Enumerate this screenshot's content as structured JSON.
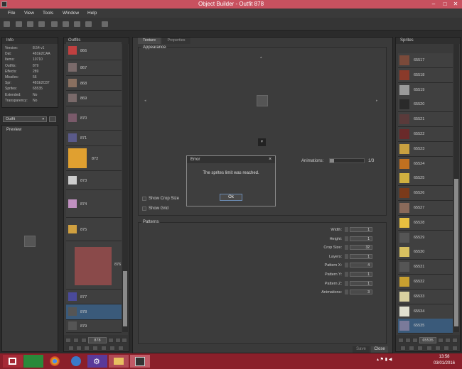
{
  "window": {
    "title": "Object Builder - Outfit 878",
    "minimize": "–",
    "maximize": "□",
    "close": "✕"
  },
  "menu": [
    "File",
    "View",
    "Tools",
    "Window",
    "Help"
  ],
  "info": {
    "header": "Info",
    "rows": [
      {
        "k": "Version:",
        "v": "8.54 v1"
      },
      {
        "k": "Dat:",
        "v": "481E2CAA"
      },
      {
        "k": "Items:",
        "v": "10710"
      },
      {
        "k": "Outfits:",
        "v": "879"
      },
      {
        "k": "Effects:",
        "v": "289"
      },
      {
        "k": "Missiles:",
        "v": "56"
      },
      {
        "k": "Spr:",
        "v": "481E2C87"
      },
      {
        "k": "Sprites:",
        "v": "65535"
      },
      {
        "k": "Extended:",
        "v": "No"
      },
      {
        "k": "Transparency:",
        "v": "No"
      }
    ]
  },
  "category_select": "Outfit",
  "preview_label": "Preview",
  "outfits": {
    "header": "Outfits",
    "items": [
      "866",
      "867",
      "868",
      "869",
      "870",
      "871",
      "872",
      "873",
      "874",
      "875",
      "876",
      "877",
      "878",
      "879"
    ],
    "selected": "878",
    "nav_value": "878"
  },
  "tabs": [
    "Texture",
    "Properties"
  ],
  "appearance": {
    "header": "Appearance",
    "animations_label": "Animations:",
    "animations_value": "1/3",
    "show_crop": "Show Crop Size",
    "show_grid": "Show Grid"
  },
  "patterns": {
    "header": "Patterns",
    "rows": [
      {
        "label": "Width:",
        "value": "1"
      },
      {
        "label": "Height:",
        "value": "1"
      },
      {
        "label": "Crop Size:",
        "value": "32"
      },
      {
        "label": "Layers:",
        "value": "1"
      },
      {
        "label": "Pattern X:",
        "value": "4"
      },
      {
        "label": "Pattern Y:",
        "value": "1"
      },
      {
        "label": "Pattern Z:",
        "value": "1"
      },
      {
        "label": "Animations:",
        "value": "3"
      }
    ]
  },
  "dialog": {
    "title": "Error",
    "message": "The sprites limit was reached.",
    "ok": "Ok",
    "close": "×"
  },
  "footer": {
    "save": "Save",
    "close": "Close"
  },
  "sprites": {
    "header": "Sprites",
    "items": [
      "65517",
      "65518",
      "65519",
      "65520",
      "65521",
      "65522",
      "65523",
      "65524",
      "65525",
      "65526",
      "65527",
      "65528",
      "65529",
      "65530",
      "65531",
      "65532",
      "65533",
      "65534",
      "65535"
    ],
    "selected": "65535",
    "nav_value": "65535"
  },
  "taskbar": {
    "time": "13:58",
    "date": "03/01/2016"
  },
  "colors": {
    "titlebar": "#c8515f",
    "taskbar": "#8a1f2a",
    "selection": "#3a5a7a",
    "window_bg": "#2b2b2b"
  }
}
